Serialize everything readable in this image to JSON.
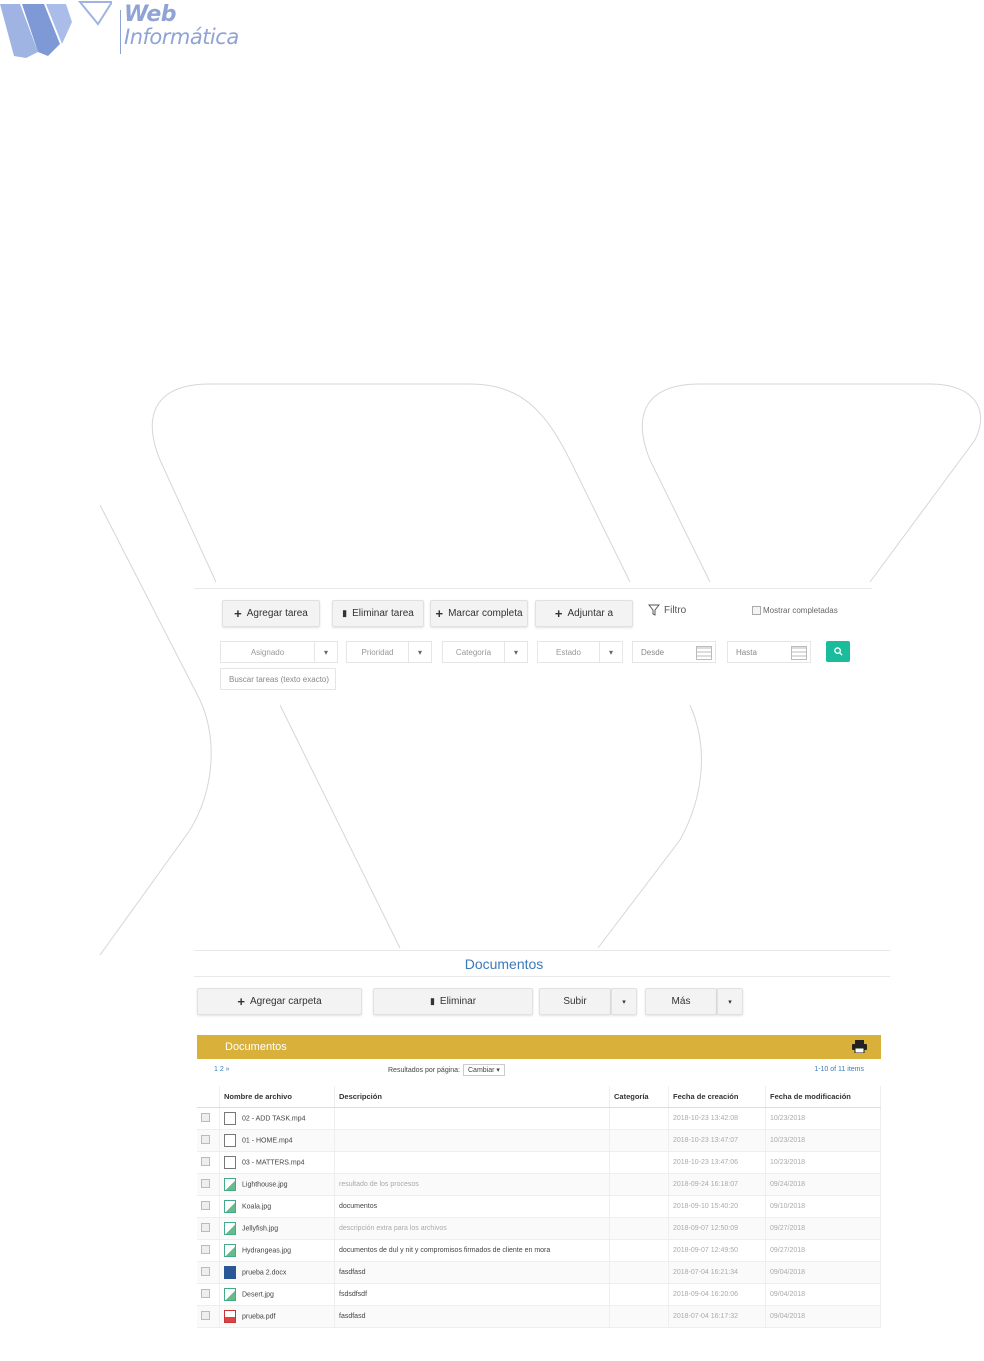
{
  "logo": {
    "line1": "Web",
    "line2": "Informática"
  },
  "tasks": {
    "buttons": {
      "add": "Agregar tarea",
      "delete": "Eliminar tarea",
      "complete": "Marcar completa",
      "attach": "Adjuntar a"
    },
    "filter_label": "Filtro",
    "show_completed": "Mostrar completadas",
    "selects": {
      "assigned": "Asignado",
      "priority": "Prioridad",
      "category": "Categoría",
      "status": "Estado"
    },
    "from_placeholder": "Desde",
    "to_placeholder": "Hasta",
    "search_placeholder": "Buscar tareas (texto exacto)"
  },
  "documents": {
    "title": "Documentos",
    "buttons": {
      "add_folder": "Agregar carpeta",
      "delete": "Eliminar",
      "upload": "Subir",
      "more": "Más"
    },
    "bar_title": "Documentos",
    "pager_pages": "1  2  »",
    "results_per_page_label": "Resultados por página:",
    "results_per_page_value": "Cambiar",
    "items_count": "1-10 of 11 items",
    "columns": [
      "Nombre de archivo",
      "Descripción",
      "Categoría",
      "Fecha de creación",
      "Fecha de modificación"
    ],
    "rows": [
      {
        "icon": "video-file-icon",
        "type": "vid",
        "name": "02 - ADD TASK.mp4",
        "desc": "",
        "created": "2018-10-23 13:42:08",
        "modified": "10/23/2018"
      },
      {
        "icon": "video-file-icon",
        "type": "vid",
        "name": "01 - HOME.mp4",
        "desc": "",
        "created": "2018-10-23 13:47:07",
        "modified": "10/23/2018"
      },
      {
        "icon": "video-file-icon",
        "type": "vid",
        "name": "03 - MATTERS.mp4",
        "desc": "",
        "created": "2018-10-23 13:47:06",
        "modified": "10/23/2018"
      },
      {
        "icon": "image-file-icon",
        "type": "img",
        "name": "Lighthouse.jpg",
        "desc": "resultado de los procesos",
        "created": "2018-09-24 16:18:07",
        "modified": "09/24/2018"
      },
      {
        "icon": "image-file-icon",
        "type": "img",
        "name": "Koala.jpg",
        "desc": "documentos",
        "created": "2018-09-10 15:40:20",
        "modified": "09/10/2018"
      },
      {
        "icon": "image-file-icon",
        "type": "img",
        "name": "Jellyfish.jpg",
        "desc": "descripción extra para los archivos",
        "created": "2018-09-07 12:50:09",
        "modified": "09/27/2018"
      },
      {
        "icon": "image-file-icon",
        "type": "img",
        "name": "Hydrangeas.jpg",
        "desc": "documentos de dul y nit y compromisos firmados de cliente en mora",
        "created": "2018-09-07 12:49:50",
        "modified": "09/27/2018"
      },
      {
        "icon": "word-file-icon",
        "type": "doc",
        "name": "prueba 2.docx",
        "desc": "fasdfasd",
        "created": "2018-07-04 16:21:34",
        "modified": "09/04/2018"
      },
      {
        "icon": "image-file-icon",
        "type": "img",
        "name": "Desert.jpg",
        "desc": "fsdsdfsdf",
        "created": "2018-09-04 16:20:06",
        "modified": "09/04/2018"
      },
      {
        "icon": "pdf-file-icon",
        "type": "pdf",
        "name": "prueba.pdf",
        "desc": "fasdfasd",
        "created": "2018-07-04 16:17:32",
        "modified": "09/04/2018"
      }
    ]
  }
}
